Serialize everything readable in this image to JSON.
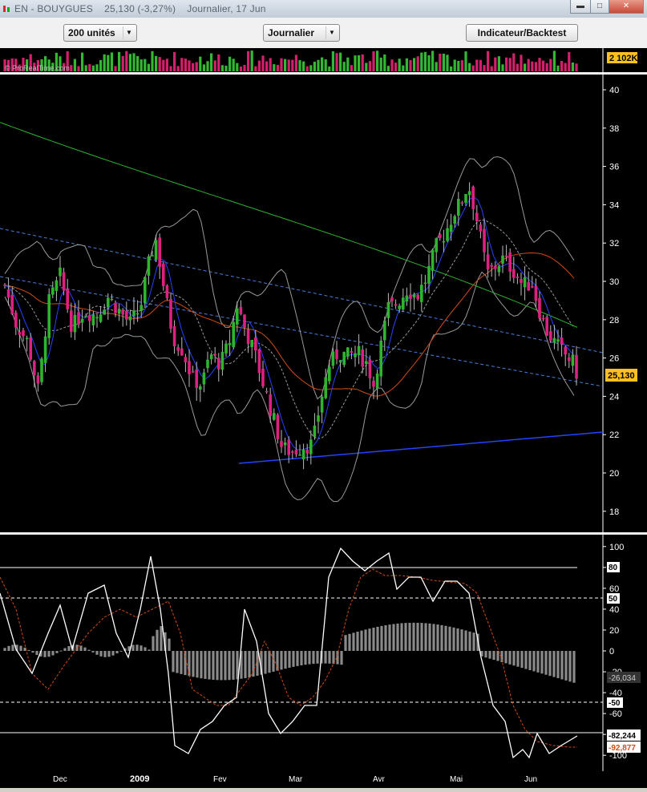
{
  "window": {
    "title": "EN - BOUYGUES    25,130 (-3,27%)    Journalier, 17 Jun",
    "minimize_glyph": "▬",
    "maximize_glyph": "□",
    "close_glyph": "✕"
  },
  "toolbar": {
    "units_label": "200 unités",
    "period_label": "Journalier",
    "indicator_label": "Indicateur/Backtest"
  },
  "volume_panel": {
    "watermark": "© ProRealTime.com",
    "current_volume_label": "2 102K"
  },
  "price_panel": {
    "current_price_label": "25,130",
    "y_ticks": [
      "40",
      "38",
      "36",
      "34",
      "32",
      "30",
      "28",
      "26",
      "24",
      "22",
      "20",
      "18"
    ]
  },
  "oscillator_panel": {
    "y_ticks": [
      "100",
      "80",
      "60",
      "40",
      "20",
      "0",
      "-20",
      "-40",
      "-60",
      "-80",
      "-100"
    ],
    "level_labels": [
      "80",
      "50",
      "-50"
    ],
    "histogram_value": "-26,034",
    "white_line_value": "-82,244",
    "orange_line_value": "-92,877"
  },
  "x_axis": {
    "labels": [
      "Dec",
      "2009",
      "Fev",
      "Mar",
      "Avr",
      "Mai",
      "Jun"
    ]
  },
  "colors": {
    "up_candle": "#2db52d",
    "down_candle": "#e02080",
    "background": "#000000",
    "ma_blue": "#2244ff",
    "ma_green": "#2fb12f",
    "ma_orange": "#d24a14",
    "bollinger": "#9a9a9a",
    "price_badge": "#ffc020"
  },
  "chart_data": {
    "type": "candlestick",
    "x_axis_labels": [
      "Dec",
      "2009",
      "Fev",
      "Mar",
      "Avr",
      "Mai",
      "Jun"
    ],
    "price_range": [
      17,
      41
    ],
    "oscillator_range": [
      -110,
      110
    ],
    "last_price": 25.13,
    "change_percent": -3.27,
    "approx_closes": [
      {
        "period": "Dec",
        "close": 28.5
      },
      {
        "period": "2009",
        "close": 31.8
      },
      {
        "period": "Fev",
        "close": 28.8
      },
      {
        "period": "Mar",
        "close": 20.9
      },
      {
        "period": "Avr",
        "close": 28.9
      },
      {
        "period": "Mai",
        "close": 35.1
      },
      {
        "period": "Jun",
        "close": 29.8
      }
    ],
    "oscillator_last": {
      "white": -82.244,
      "orange": -92.877,
      "histogram": -26.034
    }
  }
}
